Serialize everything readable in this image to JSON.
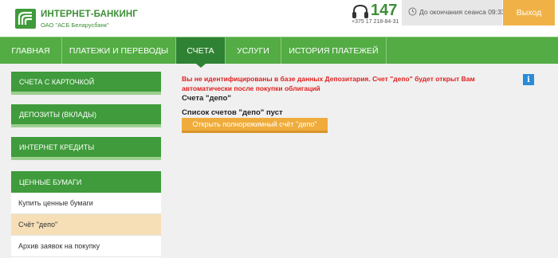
{
  "brand": {
    "title": "ИНТЕРНЕТ-БАНКИНГ",
    "subtitle": "ОАО \"АСБ Беларусбанк\"",
    "color": "#3d8f36"
  },
  "contact": {
    "short_number": "147",
    "phone": "+375 17 218-84-31",
    "icon": "headset-icon"
  },
  "session": {
    "text": "До окончания сеанса 09:33",
    "icon": "clock-icon"
  },
  "exit_label": "Выход",
  "nav": {
    "items": [
      {
        "label": "ГЛАВНАЯ"
      },
      {
        "label": "ПЛАТЕЖИ И ПЕРЕВОДЫ"
      },
      {
        "label": "СЧЕТА"
      },
      {
        "label": "УСЛУГИ"
      },
      {
        "label": "ИСТОРИЯ ПЛАТЕЖЕЙ"
      }
    ],
    "active": "СЧЕТА"
  },
  "sidebar": {
    "items": [
      {
        "label": "СЧЕТА С КАРТОЧКОЙ"
      },
      {
        "label": "ДЕПОЗИТЫ (ВКЛАДЫ)"
      },
      {
        "label": "ИНТЕРНЕТ КРЕДИТЫ"
      }
    ],
    "section": {
      "header": "ЦЕННЫЕ БУМАГИ",
      "items": [
        {
          "label": "Купить ценные бумаги"
        },
        {
          "label": "Счёт \"депо\""
        },
        {
          "label": "Архив заявок на покупку"
        }
      ],
      "selected": "Счёт \"депо\""
    }
  },
  "main": {
    "alert": "Вы не идентифицированы в базе данных Депозитария. Счет \"депо\" будет открыт Вам автоматически после покупки облигаций",
    "depo_label": "Счета \"депо\"",
    "list_label": "Список счетов \"депо\" пуст",
    "open_button": "Открыть полнорежимный счёт \"депо\"",
    "info_icon": "info-icon"
  },
  "colors": {
    "nav_green": "#53ac44",
    "nav_active": "#2f8233",
    "accent_orange": "#efac3c",
    "alert_red": "#e02020",
    "selected_bg": "#f6dfb7"
  }
}
